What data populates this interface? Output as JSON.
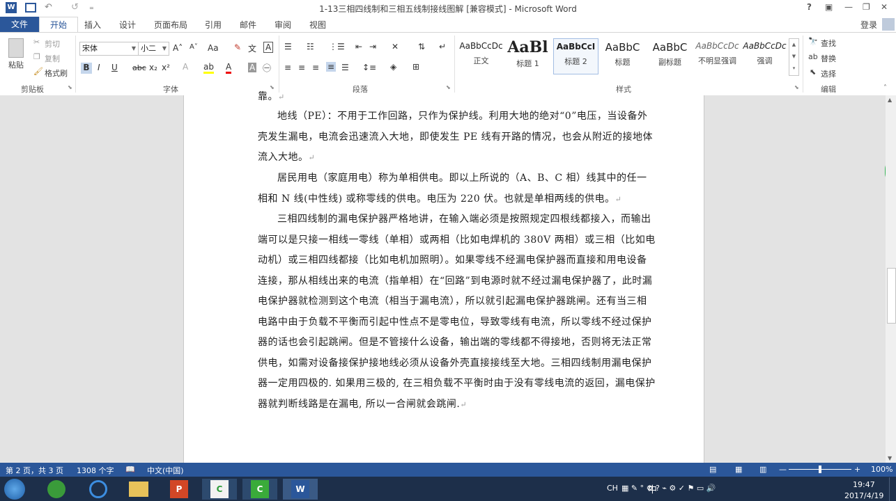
{
  "window": {
    "title": "1-13三相四线制和三相五线制接线图解 [兼容模式] - Microsoft Word",
    "help": "?",
    "minimize": "—",
    "restore": "❐",
    "close": "✕"
  },
  "qat": {
    "undo": "↶",
    "redo": "↺",
    "more": "₌"
  },
  "tabs": {
    "file": "文件",
    "items": [
      "开始",
      "插入",
      "设计",
      "页面布局",
      "引用",
      "邮件",
      "审阅",
      "视图"
    ],
    "login": "登录"
  },
  "clipboard": {
    "paste": "粘贴",
    "cut": "剪切",
    "copy": "复制",
    "format_painter": "格式刷",
    "label": "剪贴板"
  },
  "font": {
    "name": "宋体",
    "size": "小二",
    "grow": "A˄",
    "shrink": "A˅",
    "case": "Aa",
    "bold": "B",
    "italic": "I",
    "underline": "U",
    "strike": "abc",
    "sub": "x₂",
    "sup": "x²",
    "label": "字体"
  },
  "paragraph": {
    "label": "段落"
  },
  "styles": {
    "label": "样式",
    "items": [
      {
        "sample": "AaBbCcDc",
        "name": "正文"
      },
      {
        "sample": "AaBl",
        "name": "标题 1"
      },
      {
        "sample": "AaBbCcI",
        "name": "标题 2"
      },
      {
        "sample": "AaBbC",
        "name": "标题"
      },
      {
        "sample": "AaBbC",
        "name": "副标题"
      },
      {
        "sample": "AaBbCcDc",
        "name": "不明显强调"
      },
      {
        "sample": "AaBbCcDc",
        "name": "强调"
      }
    ]
  },
  "editing": {
    "find": "查找",
    "replace": "替换",
    "select": "选择",
    "label": "编辑"
  },
  "document": {
    "top_fragment": "靠。",
    "paragraphs": [
      "地线（PE）：不用于工作回路，只作为保护线。利用大地的绝对“0”电压，当设备外壳发生漏电，电流会迅速流入大地，即使发生 PE 线有开路的情况，也会从附近的接地体流入大地。",
      "居民用电（家庭用电）称为单相供电。即以上所说的（A、B、C 相）线其中的任一相和 N 线(中性线) 或称零线的供电。电压为 220 伏。也就是单相两线的供电。",
      "三相四线制的漏电保护器严格地讲，在输入端必须是按照规定四根线都接入，而输出端可以是只接一相线一零线（单相）或两相（比如电焊机的 380V 两相）或三相（比如电动机）或三相四线都接（比如电机加照明）。如果零线不经漏电保护器而直接和用电设备连接，那从相线出来的电流（指单相）在“回路”到电源时就不经过漏电保护器了，此时漏电保护器就检测到这个电流（相当于漏电流），所以就引起漏电保护器跳闸。还有当三相电路中由于负载不平衡而引起中性点不是零电位，导致零线有电流，所以零线不经过保护器的话也会引起跳闸。但是不管接什么设备，输出端的零线都不得接地，否则将无法正常供电，如需对设备接保护接地线必须从设备外壳直接接线至大地。三相四线制用漏电保护器一定用四极的. 如果用三极的, 在三相负载不平衡时由于没有零线电流的返回，漏电保护器就判断线路是在漏电, 所以一合闸就会跳闸."
    ],
    "para_mark": "↵"
  },
  "status": {
    "page": "第 2 页，共 3 页",
    "words": "1308 个字",
    "lang": "中文(中国)",
    "zoom": "100%",
    "zoom_level": 0.5
  },
  "taskbar": {
    "time": "19:47",
    "date": "2017/4/19",
    "ime": "CH",
    "ime2": "中"
  },
  "colors": {
    "accent": "#2b579a",
    "taskbar": "#1d2f4a",
    "page_bg": "#e3e3e3"
  }
}
